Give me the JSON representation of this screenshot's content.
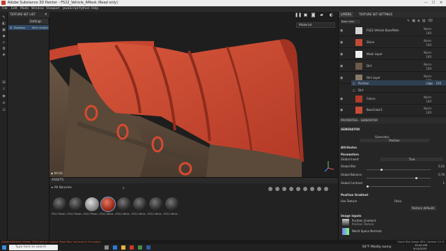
{
  "window": {
    "title": "Adobe Substance 3D Painter - FS22_Vehicle_AMask (Read only)",
    "controls": [
      "—",
      "☐",
      "✕"
    ]
  },
  "menu": [
    "File",
    "Edit",
    "Mode",
    "Window",
    "Viewport",
    "JavaScript",
    "Python",
    "Help"
  ],
  "texture_set_list": {
    "title": "TEXTURE SET LIST",
    "settings_label": "Settings",
    "row_name": "Roadbox",
    "row_shader": "Main shader"
  },
  "viewport": {
    "material_dropdown": "Material",
    "mask_label": "MASK"
  },
  "assets": {
    "title": "ASSETS",
    "library_label": "All libraries",
    "items": [
      "FS22 Plasti...",
      "FS22 Plasti...",
      "FS22 Plasti...",
      "FS22 Vehic...",
      "FS22 Vehic...",
      "FS22 Vehic...",
      "FS22 Vehic...",
      "FS22 Vehic..."
    ]
  },
  "layers_panel": {
    "tabs": [
      "LAYERS",
      "TEXTURE SET SETTINGS"
    ],
    "channel": "Base color",
    "layers": [
      {
        "name": "FS22 Vehicle BasePlate",
        "blend": "Norm",
        "opacity": "100",
        "thumb": "#d6d6d6"
      },
      {
        "name": "Shine",
        "blend": "Norm",
        "opacity": "100",
        "thumb": "#c24a33"
      },
      {
        "name": "Mask Layer",
        "blend": "Norm",
        "opacity": "100",
        "thumb": "#f0f0f0"
      },
      {
        "name": "Dirt",
        "blend": "Norm",
        "opacity": "100",
        "thumb": "#6b5a48"
      },
      {
        "name": "Dirt Layer",
        "blend": "Norm",
        "opacity": "100",
        "thumb": "#8a7a6a"
      },
      {
        "name": "Position",
        "blend": "Ldge",
        "opacity": "100",
        "thumb": "#eeeeee"
      },
      {
        "name": "Dirt",
        "blend": "",
        "opacity": "",
        "thumb": "#cfcfcf"
      },
      {
        "name": "Colors",
        "blend": "Norm",
        "opacity": "100",
        "thumb": "#b23a2a"
      },
      {
        "name": "BaseColor1",
        "blend": "Norm",
        "opacity": "100",
        "thumb": "#c94b35"
      }
    ]
  },
  "properties": {
    "title": "PROPERTIES - GENERATOR",
    "section_generator": "GENERATOR",
    "generator_label": "Generator",
    "generator_value": "Position",
    "attributes_label": "Attributes",
    "parameters_label": "Parameters",
    "params": [
      {
        "name": "Global Invert",
        "value": "True"
      },
      {
        "name": "Global Blur",
        "value": "0.22",
        "level": 0.22
      },
      {
        "name": "Global Balance",
        "value": "0.76",
        "level": 0.76
      },
      {
        "name": "Global Contrast",
        "value": "1",
        "level": 0.0
      }
    ],
    "position_gradient": "Position Gradient",
    "use_texture_label": "Use Texture",
    "use_texture_value": "False",
    "restore_defaults": "Restore defaults",
    "image_inputs": "Image inputs",
    "input1_name": "Position Gradient",
    "input1_sub": "Position Texture",
    "input2_name": "World Space Normals"
  },
  "statusbar": "[GenericMaterial] Shader 'FS22 Vehicle': texture 'Mask Map' not found in the project.",
  "statusbar_right": "Cache Disk Usage:   85%  |  Version: 9.1.0",
  "taskbar": {
    "search": "Type here to search",
    "weather": "64°F  Mostly sunny",
    "time": "10:40 AM",
    "date": "9/14/2023"
  }
}
